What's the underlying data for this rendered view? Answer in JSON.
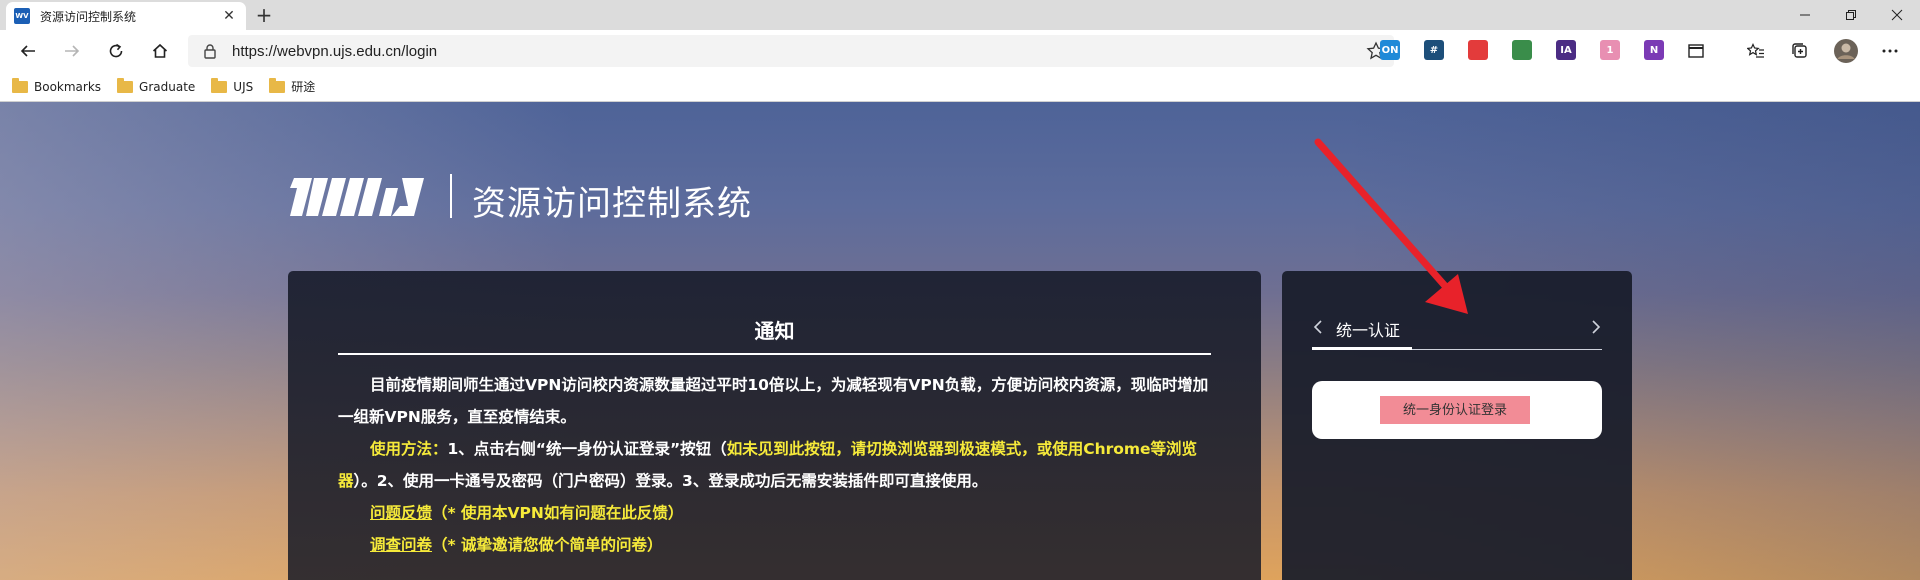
{
  "browser": {
    "tab": {
      "favicon_text": "WV",
      "title": "资源访问控制系统"
    },
    "url": "https://webvpn.ujs.edu.cn/login",
    "bookmarks": [
      {
        "label": "Bookmarks"
      },
      {
        "label": "Graduate"
      },
      {
        "label": "UJS"
      },
      {
        "label": "研途"
      }
    ],
    "extensions": [
      {
        "icon": "on-extension-icon",
        "text": "ON",
        "color": "#1f8ad8"
      },
      {
        "icon": "hashtag-extension-icon",
        "text": "#",
        "color": "#1d4f7a"
      },
      {
        "icon": "red-extension-icon",
        "text": "",
        "color": "#e33b3b"
      },
      {
        "icon": "globe-extension-icon",
        "text": "",
        "color": "#3a8d4a"
      },
      {
        "icon": "ia-extension-icon",
        "text": "IA",
        "color": "#4b2c84"
      },
      {
        "icon": "cat-extension-icon",
        "text": "1",
        "color": "#e88fb2"
      },
      {
        "icon": "onenote-extension-icon",
        "text": "N",
        "color": "#7b3ab5"
      }
    ]
  },
  "page": {
    "site_title": "资源访问控制系统",
    "notice": {
      "title": "通知",
      "paragraph1": "目前疫情期间师生通过VPN访问校内资源数量超过平时10倍以上，为减轻现有VPN负载，方便访问校内资源，现临时增加一组新VPN服务，直至疫情结束。",
      "usage_label": "使用方法：",
      "usage_text1": "1、点击右侧“统一身份认证登录”按钮（",
      "usage_highlight": "如未见到此按钮，请切换浏览器到极速模式，或使用Chrome等浏览器",
      "usage_text2": "）。2、使用一卡通号及密码（门户密码）登录。3、登录成功后无需安装插件即可直接使用。",
      "feedback_link": "问题反馈",
      "feedback_note": "（* 使用本VPN如有问题在此反馈）",
      "survey_link": "调查问卷",
      "survey_note": "（* 诚挚邀请您做个简单的问卷）"
    },
    "login": {
      "tab_label": "统一认证",
      "sso_button": "统一身份认证登录"
    }
  },
  "colors": {
    "highlight_yellow": "#f6ea3a",
    "sso_button": "#f28c96",
    "annotation_arrow": "#e8222a"
  }
}
